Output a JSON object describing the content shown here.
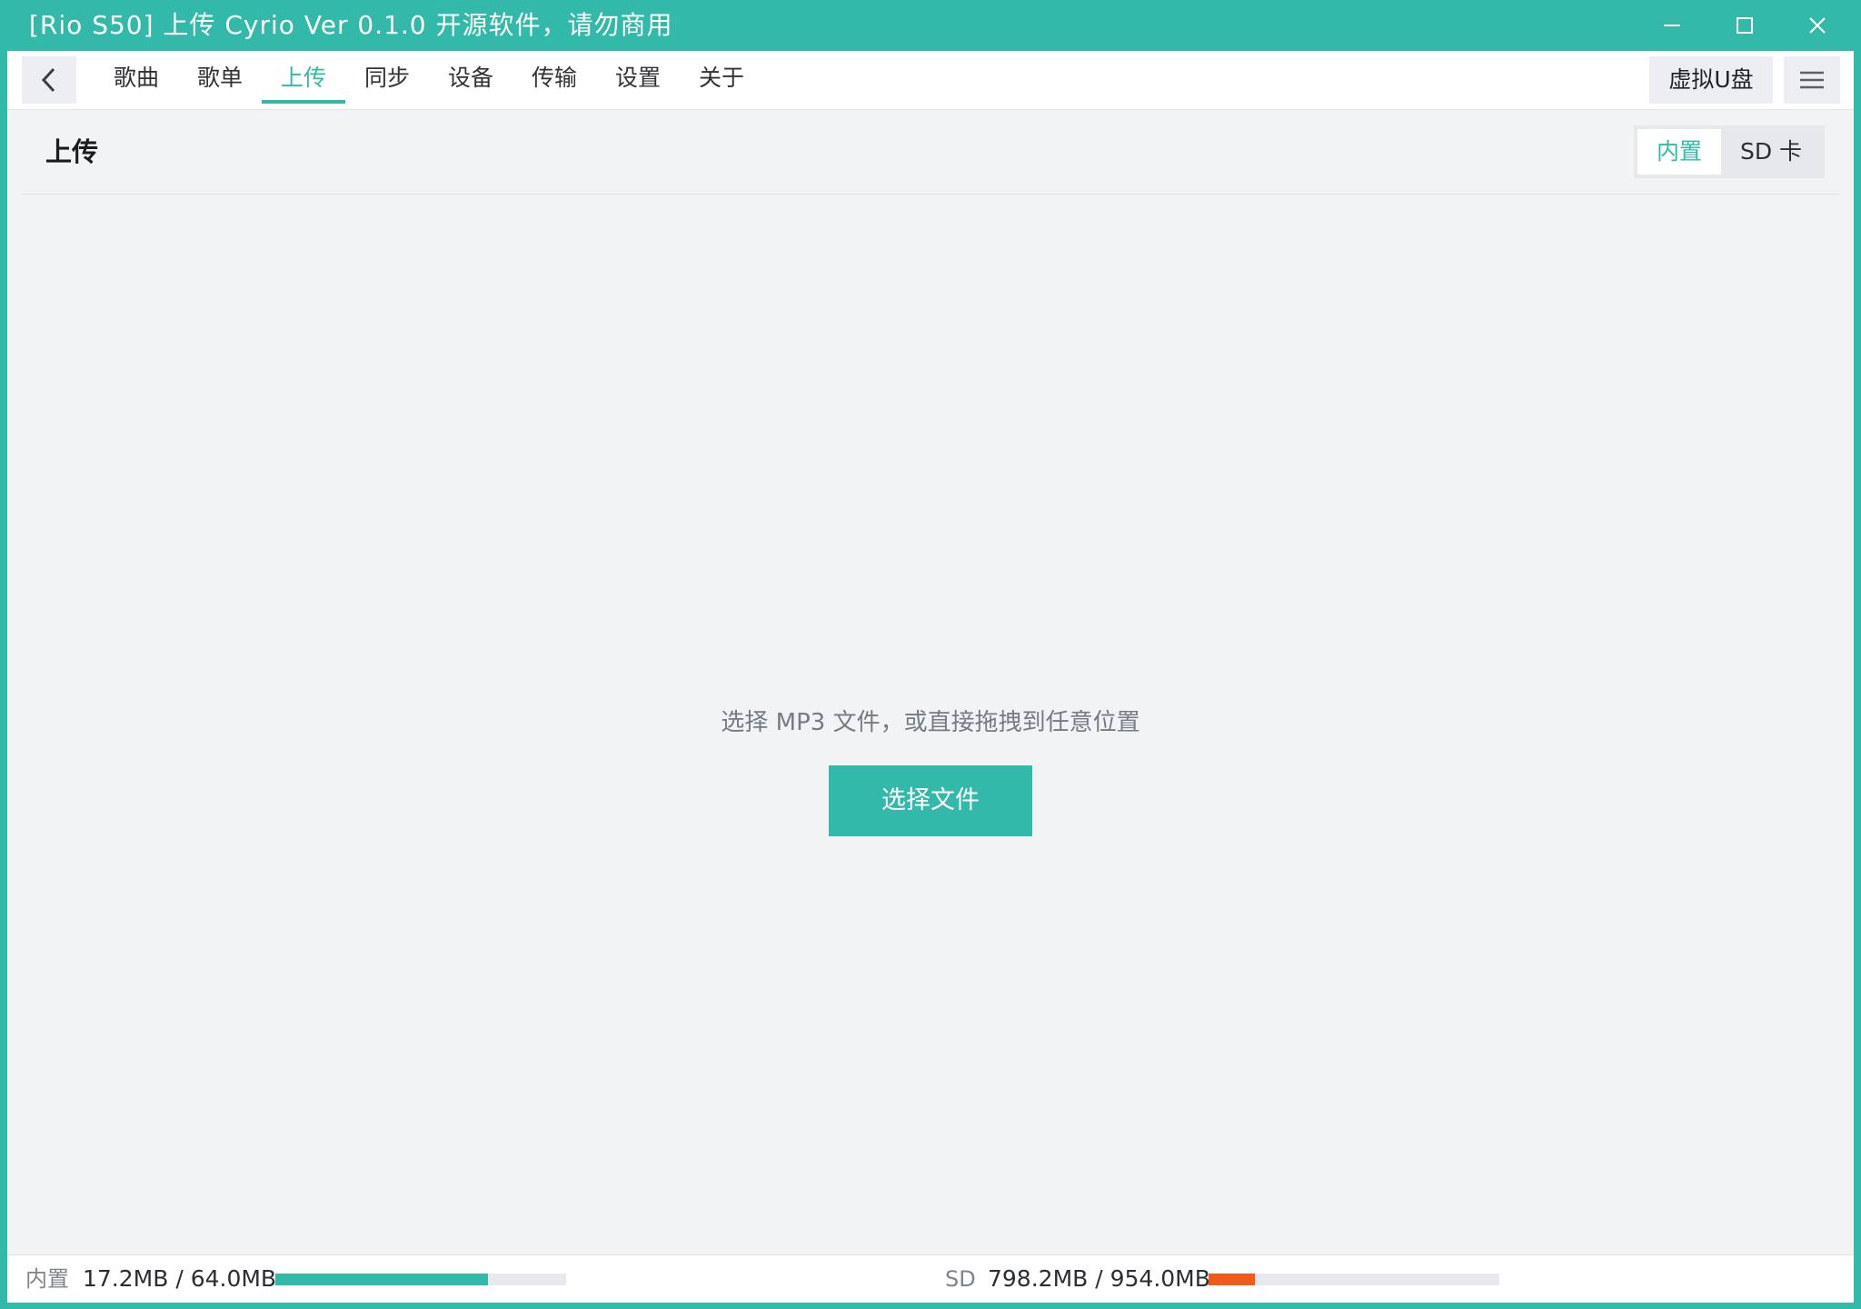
{
  "window": {
    "title": "[Rio S50] 上传 Cyrio Ver 0.1.0 开源软件，请勿商用",
    "controls": [
      "minimize-icon",
      "maximize-icon",
      "close-icon"
    ]
  },
  "nav": {
    "back_icon": "chevron-left-icon",
    "tabs": [
      {
        "label": "歌曲"
      },
      {
        "label": "歌单"
      },
      {
        "label": "上传"
      },
      {
        "label": "同步"
      },
      {
        "label": "设备"
      },
      {
        "label": "传输"
      },
      {
        "label": "设置"
      },
      {
        "label": "关于"
      }
    ],
    "active_tab": "上传",
    "virtual_disk_label": "虚拟U盘",
    "menu_icon": "hamburger-menu-icon"
  },
  "page": {
    "title": "上传",
    "storage_toggle": {
      "options": [
        {
          "label": "内置"
        },
        {
          "label": "SD 卡"
        }
      ],
      "selected": "内置"
    }
  },
  "dropzone": {
    "hint": "选择 MP3 文件，或直接拖拽到任意位置",
    "button_label": "选择文件"
  },
  "status": {
    "internal": {
      "label": "内置",
      "usage": "17.2MB / 64.0MB",
      "used_fraction": 0.73,
      "color": "#33b9aa"
    },
    "sd": {
      "label": "SD",
      "usage": "798.2MB / 954.0MB",
      "used_fraction": 0.16,
      "color": "#f25a19"
    }
  },
  "colors": {
    "accent": "#33b9aa",
    "background": "#f2f3f5",
    "sd_bar": "#f25a19"
  }
}
